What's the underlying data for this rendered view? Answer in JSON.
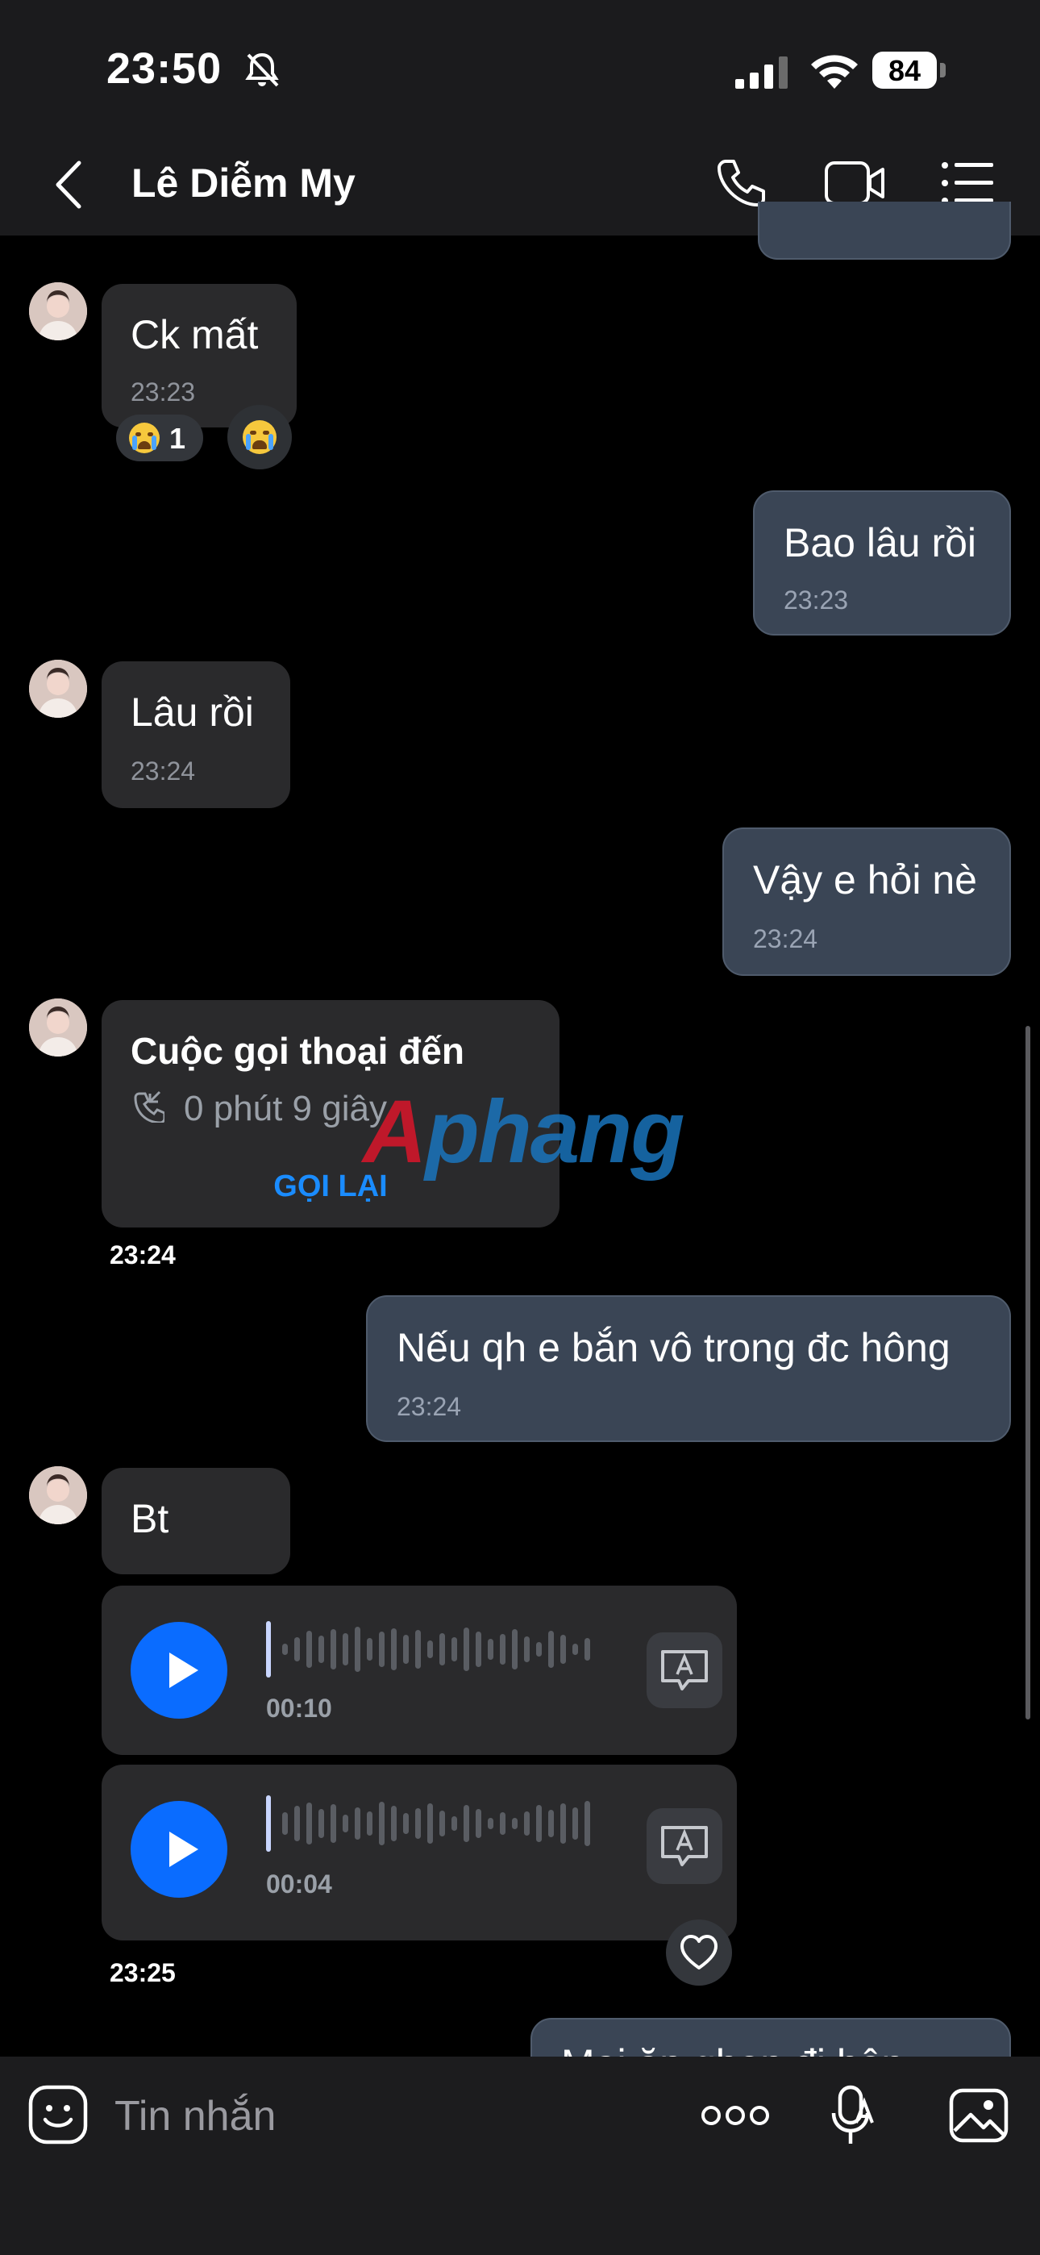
{
  "status_bar": {
    "time": "23:50",
    "battery": "84"
  },
  "header": {
    "contact_name": "Lê Diễm My"
  },
  "messages": [
    {
      "text": "Ck mất",
      "time": "23:23",
      "reaction_count": "1"
    },
    {
      "text": "Bao lâu rồi",
      "time": "23:23"
    },
    {
      "text": "Lâu rồi",
      "time": "23:24"
    },
    {
      "text": "Vậy e hỏi nè",
      "time": "23:24"
    },
    {
      "title": "Cuộc gọi thoại đến",
      "duration": "0 phút 9 giây",
      "action": "GỌI LẠI",
      "time": "23:24"
    },
    {
      "text": "Nếu qh e bắn vô trong đc hông",
      "time": "23:24"
    },
    {
      "text": "Bt"
    },
    {
      "duration": "00:10"
    },
    {
      "duration": "00:04",
      "time": "23:25"
    },
    {
      "text": "Mai ăn ghen đi hôn"
    }
  ],
  "watermark": {
    "prefix": "A",
    "suffix": "phang"
  },
  "composer": {
    "placeholder": "Tin nhắn"
  },
  "colors": {
    "accent": "#0a6cff",
    "outgoing_bubble": "#3a4555",
    "incoming_bubble": "#2a2a2c"
  }
}
